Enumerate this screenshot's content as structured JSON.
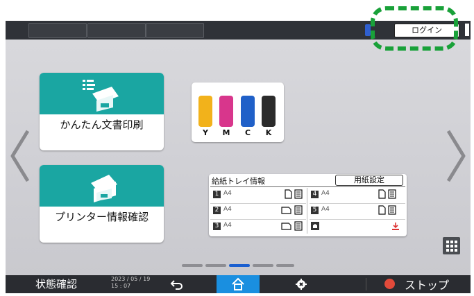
{
  "header": {
    "login_label": "ログイン"
  },
  "tiles": [
    {
      "label": "かんたん文書印刷",
      "icon": "document-print-icon"
    },
    {
      "label": "プリンター情報確認",
      "icon": "printer-info-icon"
    }
  ],
  "toner": {
    "cartridges": [
      {
        "letter": "Y",
        "color": "#f2b21b"
      },
      {
        "letter": "M",
        "color": "#d8368c"
      },
      {
        "letter": "C",
        "color": "#2060c8"
      },
      {
        "letter": "K",
        "color": "#2b2b2b"
      }
    ]
  },
  "paper_tray": {
    "title": "給紙トレイ情報",
    "settings_button": "用紙設定",
    "trays": [
      {
        "number": "1",
        "size": "A4",
        "orientation": "portrait"
      },
      {
        "number": "2",
        "size": "A4",
        "orientation": "landscape"
      },
      {
        "number": "3",
        "size": "A4",
        "orientation": "landscape"
      },
      {
        "number": "4",
        "size": "A4",
        "orientation": "portrait"
      },
      {
        "number": "5",
        "size": "A4",
        "orientation": "portrait"
      }
    ],
    "bypass_icon": "bypass-tray-icon"
  },
  "pager": {
    "total": 5,
    "active_index": 2
  },
  "bottom": {
    "status_label": "状態確認",
    "date": "2023 / 05 / 19",
    "time": "15 : 07",
    "stop_label": "ストップ"
  },
  "colors": {
    "accent_teal": "#1aa6a2",
    "home_blue": "#1a8fe0",
    "highlight_green": "#19a139",
    "stop_red": "#e24a3a"
  }
}
